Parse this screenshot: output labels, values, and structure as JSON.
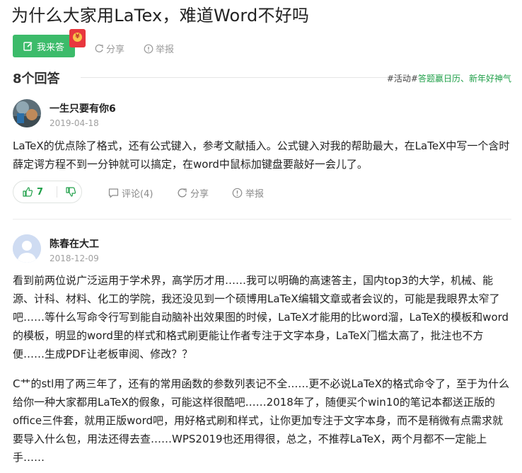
{
  "question": {
    "title": "为什么大家用LaTex，难道Word不好吗",
    "answer_button": "我来答",
    "share_label": "分享",
    "report_label": "举报"
  },
  "answers_header": {
    "count_label": "8个回答",
    "activity_tag": "#活动#",
    "activity_text": "答题赢日历、新年好神气"
  },
  "answers": [
    {
      "user": "一生只要有你6",
      "date": "2019-04-18",
      "paragraphs": [
        "LaTeX的优点除了格式，还有公式键入，参考文献插入。公式键入对我的帮助最大，在LaTeX中写一个含时薛定谔方程不到一分钟就可以搞定，在word中鼠标加键盘要敲好一会儿了。"
      ],
      "likes": "7",
      "comment_label": "评论(4)",
      "share_label": "分享",
      "report_label": "举报"
    },
    {
      "user": "陈春在大工",
      "date": "2018-12-09",
      "paragraphs": [
        "看到前两位说广泛运用于学术界，高学历才用……我可以明确的高速答主，国内top3的大学，机械、能源、计科、材料、化工的学院，我还没见到一个硕博用LaTeX编辑文章或者会议的，可能是我眼界太窄了吧……等什么写命令行写到能自动脑补出效果图的时候，LaTeX才能用的比word溜，LaTeX的模板和word的模板，明显的word里的样式和格式刷更能让作者专注于文字本身，LaTeX门槛太高了，批注也不方便……生成PDF让老板审阅、修改？？",
        "C艹的stl用了两三年了，还有的常用函数的参数列表记不全……更不必说LaTeX的格式命令了，至于为什么给你一种大家都用LaTeX的假象，可能这样很酷吧……2018年了，随便买个win10的笔记本都送正版的office三件套，就用正版word吧，用好格式刷和样式，让你更加专注于文字本身，而不是稍微有点需求就要导入什么包，用法还得去查……WPS2019也还用得很，总之，不推荐LaTeX，两个月都不一定能上手……"
      ]
    }
  ],
  "colors": {
    "brand_green": "#3cbb6a",
    "link_green": "#21a04a",
    "muted_gray": "#9a9a9a"
  },
  "icons": [
    "edit-icon",
    "red-packet-icon",
    "share-icon",
    "report-icon",
    "thumbs-up-icon",
    "thumbs-down-icon",
    "comment-icon"
  ]
}
